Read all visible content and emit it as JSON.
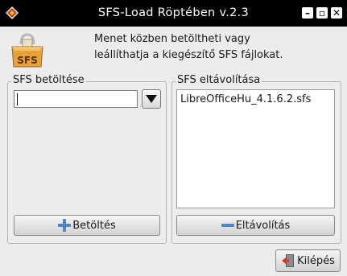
{
  "window": {
    "title": "SFS-Load Röptében v.2.3",
    "minimize_glyph": "–",
    "maximize_glyph": "▫",
    "close_glyph": "✕"
  },
  "header": {
    "icon_text": "SFS",
    "line1": "Menet közben betöltheti vagy",
    "line2": "leállíthatja a kiegészítő SFS fájlokat."
  },
  "load_panel": {
    "title": "SFS betöltése",
    "entry_value": "",
    "load_button_label": "Betöltés"
  },
  "unload_panel": {
    "title": "SFS eltávolítása",
    "items": [
      "LibreOfficeHu_4.1.6.2.sfs"
    ],
    "unload_button_label": "Eltávolítás"
  },
  "footer": {
    "exit_button_label": "Kilépés"
  },
  "icons": {
    "app": "diamond-app-icon",
    "header": "sfs-package-icon",
    "load": "plus-icon",
    "unload": "minus-icon",
    "exit": "exit-door-icon"
  }
}
